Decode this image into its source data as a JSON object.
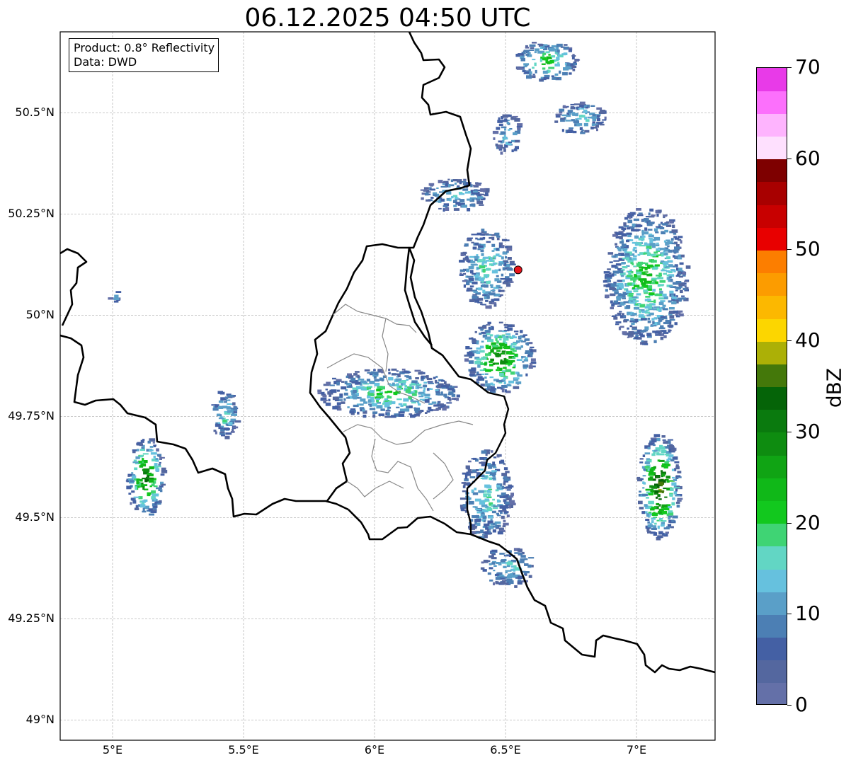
{
  "title": "06.12.2025 04:50 UTC",
  "info": {
    "product": "Product: 0.8° Reflectivity",
    "source": "Data: DWD"
  },
  "map": {
    "lon_range": [
      4.8,
      7.3
    ],
    "lat_range": [
      48.95,
      50.7
    ],
    "radar_site": {
      "lon": 6.548,
      "lat": 50.112,
      "color": "#e8141c"
    },
    "lat_ticks": [
      {
        "value": 50.5,
        "label": "50.5°N"
      },
      {
        "value": 50.25,
        "label": "50.25°N"
      },
      {
        "value": 50.0,
        "label": "50°N"
      },
      {
        "value": 49.75,
        "label": "49.75°N"
      },
      {
        "value": 49.5,
        "label": "49.5°N"
      },
      {
        "value": 49.25,
        "label": "49.25°N"
      },
      {
        "value": 49.0,
        "label": "49°N"
      }
    ],
    "lon_ticks": [
      {
        "value": 5.0,
        "label": "5°E"
      },
      {
        "value": 5.5,
        "label": "5.5°E"
      },
      {
        "value": 6.0,
        "label": "6°E"
      },
      {
        "value": 6.5,
        "label": "6.5°E"
      },
      {
        "value": 7.0,
        "label": "7°E"
      }
    ],
    "grid": true
  },
  "colorbar": {
    "unit": "dBZ",
    "min": 0,
    "max": 70,
    "tick_values": [
      0,
      10,
      20,
      30,
      40,
      50,
      60,
      70
    ],
    "tick_labels": [
      "0",
      "10",
      "20",
      "30",
      "40",
      "50",
      "60",
      "70"
    ],
    "colors": [
      "#6470a8",
      "#54679f",
      "#4460a4",
      "#4c7fb4",
      "#5a9fc8",
      "#66c1de",
      "#62d6c4",
      "#3fd474",
      "#12c81e",
      "#10b818",
      "#10a414",
      "#0e8c10",
      "#0a7a0e",
      "#056408",
      "#44780a",
      "#acb006",
      "#fcd600",
      "#fcb800",
      "#fc9c00",
      "#fc7e00",
      "#e80000",
      "#c80000",
      "#a80000",
      "#7e0000",
      "#fee0fe",
      "#feb4fe",
      "#fc70fc",
      "#e83ae8"
    ]
  },
  "echo_regions": [
    {
      "lon": 6.47,
      "lat": 49.9,
      "rlon": 0.13,
      "rlat": 0.09,
      "level": 12
    },
    {
      "lon": 6.05,
      "lat": 49.81,
      "rlon": 0.27,
      "rlat": 0.06,
      "level": 8
    },
    {
      "lon": 6.42,
      "lat": 50.12,
      "rlon": 0.1,
      "rlat": 0.1,
      "level": 7
    },
    {
      "lon": 6.3,
      "lat": 50.3,
      "rlon": 0.13,
      "rlat": 0.04,
      "level": 6
    },
    {
      "lon": 6.42,
      "lat": 49.56,
      "rlon": 0.1,
      "rlat": 0.11,
      "level": 7
    },
    {
      "lon": 6.5,
      "lat": 49.38,
      "rlon": 0.1,
      "rlat": 0.05,
      "level": 6
    },
    {
      "lon": 7.03,
      "lat": 50.1,
      "rlon": 0.16,
      "rlat": 0.17,
      "level": 9
    },
    {
      "lon": 7.08,
      "lat": 49.58,
      "rlon": 0.08,
      "rlat": 0.13,
      "level": 16
    },
    {
      "lon": 5.12,
      "lat": 49.6,
      "rlon": 0.07,
      "rlat": 0.1,
      "level": 13
    },
    {
      "lon": 5.42,
      "lat": 49.76,
      "rlon": 0.05,
      "rlat": 0.06,
      "level": 7
    },
    {
      "lon": 6.65,
      "lat": 50.63,
      "rlon": 0.12,
      "rlat": 0.05,
      "level": 9
    },
    {
      "lon": 6.78,
      "lat": 50.49,
      "rlon": 0.1,
      "rlat": 0.04,
      "level": 6
    },
    {
      "lon": 6.5,
      "lat": 50.45,
      "rlon": 0.05,
      "rlat": 0.05,
      "level": 6
    },
    {
      "lon": 5.0,
      "lat": 50.05,
      "rlon": 0.02,
      "rlat": 0.015,
      "level": 6
    }
  ]
}
